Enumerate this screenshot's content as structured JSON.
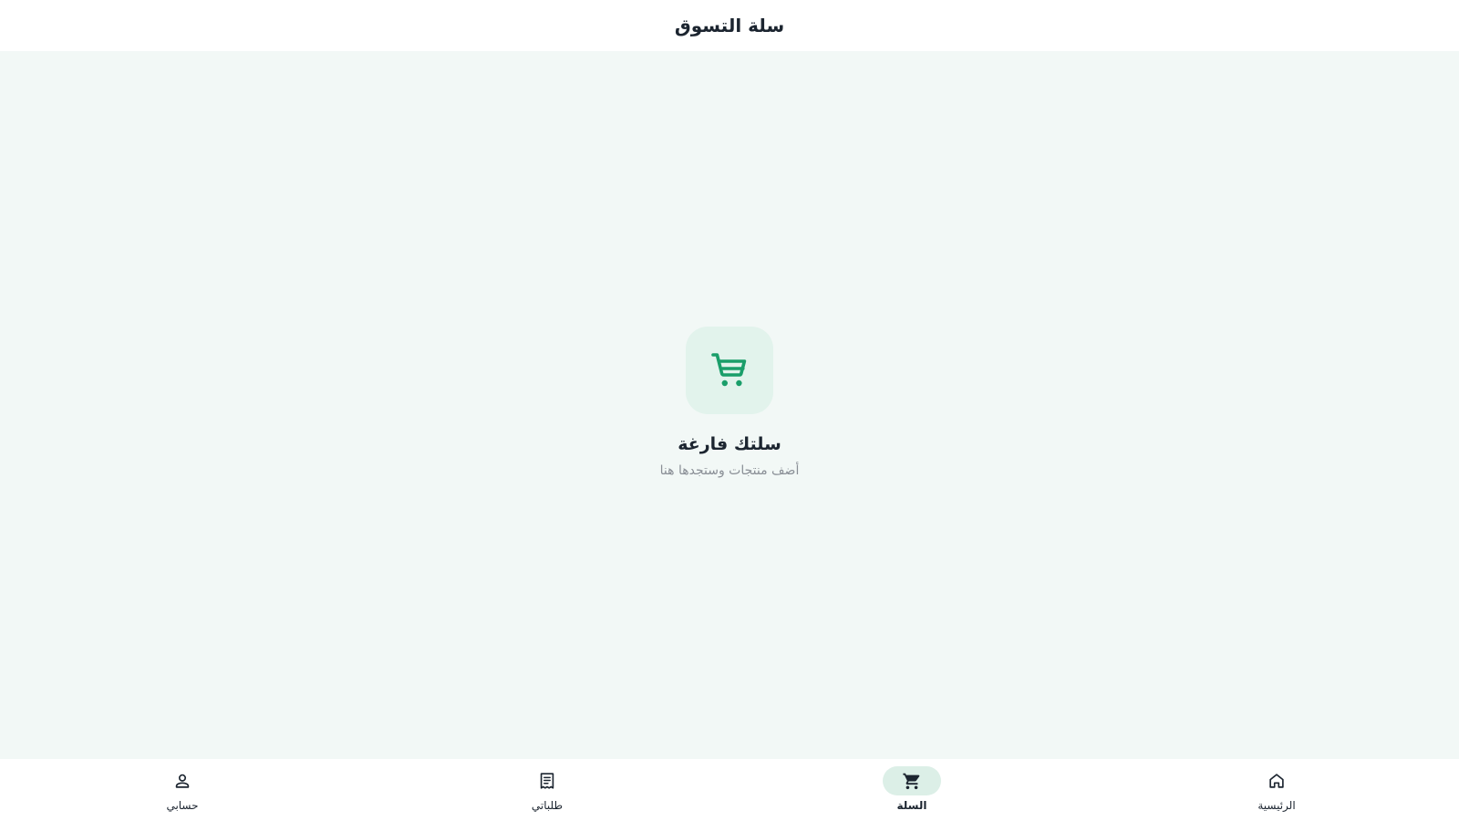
{
  "app_bar": {
    "title": "سلة التسوق"
  },
  "empty_state": {
    "icon": "shopping-cart-icon",
    "title": "سلتك فارغة",
    "subtitle": "أضف منتجات وستجدها هنا"
  },
  "bottom_nav": {
    "items": [
      {
        "label": "الرئيسية",
        "icon": "home-icon",
        "active": false
      },
      {
        "label": "السلة",
        "icon": "shopping-cart-icon",
        "active": true
      },
      {
        "label": "طلباتي",
        "icon": "receipt-icon",
        "active": false
      },
      {
        "label": "حسابي",
        "icon": "person-icon",
        "active": false
      }
    ]
  },
  "colors": {
    "accent": "#1a9e6a",
    "background": "#f2f8f6",
    "surface": "#ffffff",
    "icon_box": "#e2f3ec",
    "active_indicator": "#dcefe7",
    "text_primary": "#1c2530",
    "text_secondary": "#8a8f96"
  }
}
